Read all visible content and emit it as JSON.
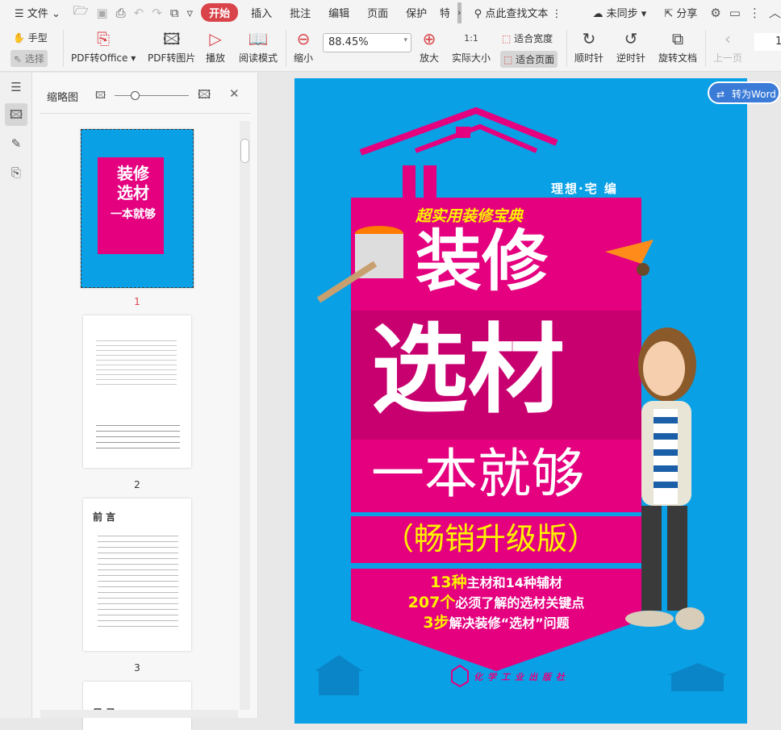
{
  "menubar": {
    "file": "文件",
    "tabs": [
      "开始",
      "插入",
      "批注",
      "编辑",
      "页面",
      "保护",
      "特色"
    ],
    "active_tab": "开始",
    "search_placeholder": "点此查找文本",
    "sync": "未同步",
    "share": "分享"
  },
  "toolbar": {
    "hand": "手型",
    "select": "选择",
    "pdf_to_office": "PDF转Office",
    "pdf_to_image": "PDF转图片",
    "play": "播放",
    "read_mode": "阅读模式",
    "zoom_out": "缩小",
    "zoom_value": "88.45%",
    "zoom_in": "放大",
    "actual_size": "实际大小",
    "actual_size_icon": "1:1",
    "fit_width": "适合宽度",
    "fit_page": "适合页面",
    "clockwise": "顺时针",
    "counterclockwise": "逆时针",
    "rotate_doc": "旋转文档",
    "prev_page": "上一页",
    "page_number": "1"
  },
  "panel": {
    "title": "缩略图",
    "pages": [
      {
        "label": "1"
      },
      {
        "label": "2"
      },
      {
        "label": "3"
      }
    ],
    "page3_heading": "前 言",
    "page4_heading": "目 录"
  },
  "cover": {
    "editor": "理想·宅 编",
    "series": "超实用装修宝典",
    "title1": "装修",
    "title2": "选材",
    "title3": "一本就够",
    "edition": "（畅销升级版）",
    "points": [
      {
        "num": "13种",
        "text": "主材和14种辅材"
      },
      {
        "num": "207个",
        "text": "必须了解的选材关键点"
      },
      {
        "num": "3步",
        "text": "解决装修“选材”问题"
      }
    ],
    "publisher": "化学工业出版社"
  },
  "convert_word": "转为Word",
  "colors": {
    "accent": "#d9434a",
    "cover_blue": "#0aa0e6",
    "cover_pink": "#e4007f",
    "highlight_yellow": "#fff200"
  }
}
